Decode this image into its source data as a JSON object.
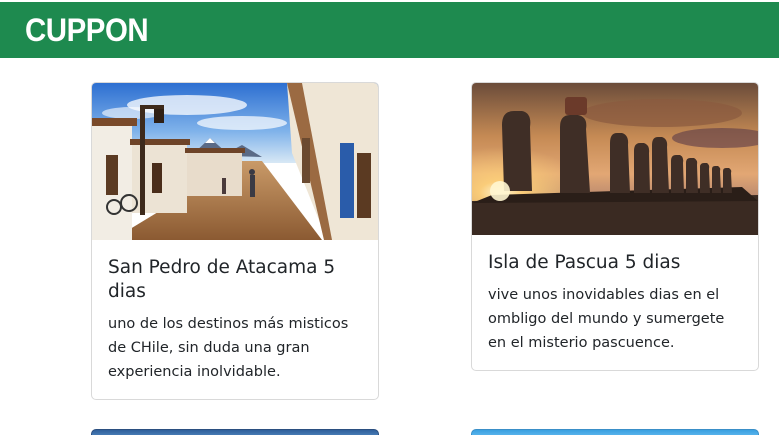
{
  "header": {
    "brand": "CUPPON",
    "background_color": "#1e8a4f"
  },
  "cards": [
    {
      "image_name": "atacama-street-photo",
      "title": "San Pedro de Atacama 5 dias",
      "text": "uno de los destinos más misticos de CHile, sin duda una gran experiencia inolvidable."
    },
    {
      "image_name": "easter-island-moai-photo",
      "title": "Isla de Pascua 5 dias",
      "text": "vive unos inovidables dias en el ombligo del mundo y sumergete en el misterio pascuence."
    }
  ]
}
